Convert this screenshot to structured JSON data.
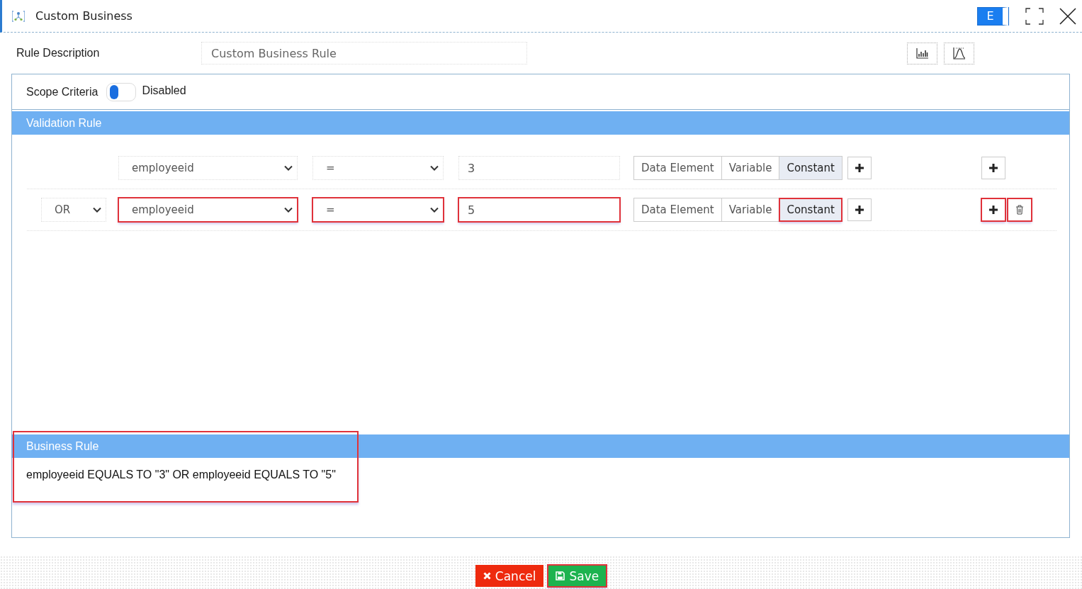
{
  "window": {
    "title": "Custom Business",
    "mode_badge": "E"
  },
  "rule_description": {
    "label": "Rule Description",
    "value": "Custom Business Rule"
  },
  "scope_criteria": {
    "label": "Scope Criteria",
    "on": false,
    "state_text": "Disabled"
  },
  "validation_rule": {
    "title": "Validation Rule",
    "conditions": [
      {
        "field": "employeeid",
        "operator": "=",
        "value": "3",
        "highlighted": false,
        "deletable": false,
        "value_types": [
          {
            "label": "Data Element",
            "selected": false
          },
          {
            "label": "Variable",
            "selected": false
          },
          {
            "label": "Constant",
            "selected": true
          }
        ]
      },
      {
        "connector": "OR",
        "field": "employeeid",
        "operator": "=",
        "value": "5",
        "highlighted": true,
        "deletable": true,
        "value_types": [
          {
            "label": "Data Element",
            "selected": false
          },
          {
            "label": "Variable",
            "selected": false
          },
          {
            "label": "Constant",
            "selected": true
          }
        ]
      }
    ]
  },
  "business_rule": {
    "title": "Business Rule",
    "text": "employeeid EQUALS TO \"3\" OR employeeid EQUALS TO \"5\"",
    "highlighted": true
  },
  "buttons": [
    {
      "kind": "cancel",
      "label": "Cancel",
      "highlighted": false
    },
    {
      "kind": "save",
      "label": "Save",
      "highlighted": true
    }
  ]
}
